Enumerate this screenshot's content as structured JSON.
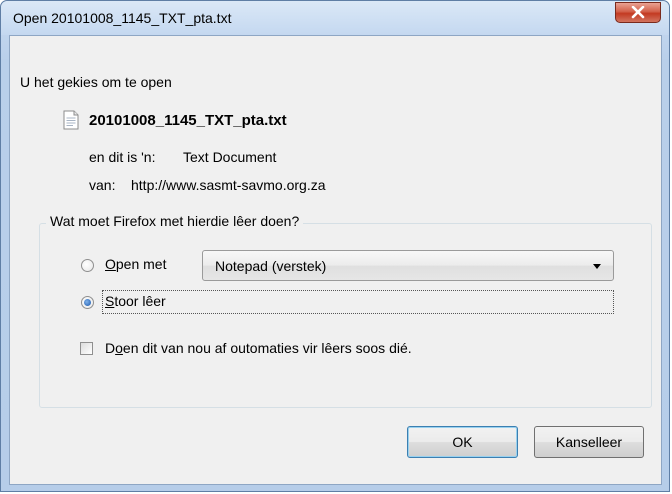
{
  "window": {
    "title": "Open 20101008_1145_TXT_pta.txt"
  },
  "intro_text": "U het gekies om te open",
  "file": {
    "name": "20101008_1145_TXT_pta.txt",
    "type_label": "en dit is 'n:",
    "type_value": "Text Document",
    "from_label": "van:",
    "from_value": "http://www.sasmt-savmo.org.za"
  },
  "action_group": {
    "title": "Wat moet Firefox met hierdie lêer doen?",
    "open_with": {
      "accesskey": "O",
      "rest": "pen met",
      "selected": false
    },
    "app_select": {
      "value": "Notepad (verstek)"
    },
    "save_file": {
      "accesskey": "S",
      "rest": "toor lêer",
      "selected": true
    },
    "remember": {
      "pre": "D",
      "accesskey": "o",
      "rest": "en dit van nou af outomaties vir lêers soos dié.",
      "checked": false
    }
  },
  "buttons": {
    "ok": "OK",
    "cancel": "Kanselleer"
  },
  "icons": {
    "close": "close-icon",
    "file": "text-file-icon",
    "dropdown": "chevron-down-icon"
  }
}
